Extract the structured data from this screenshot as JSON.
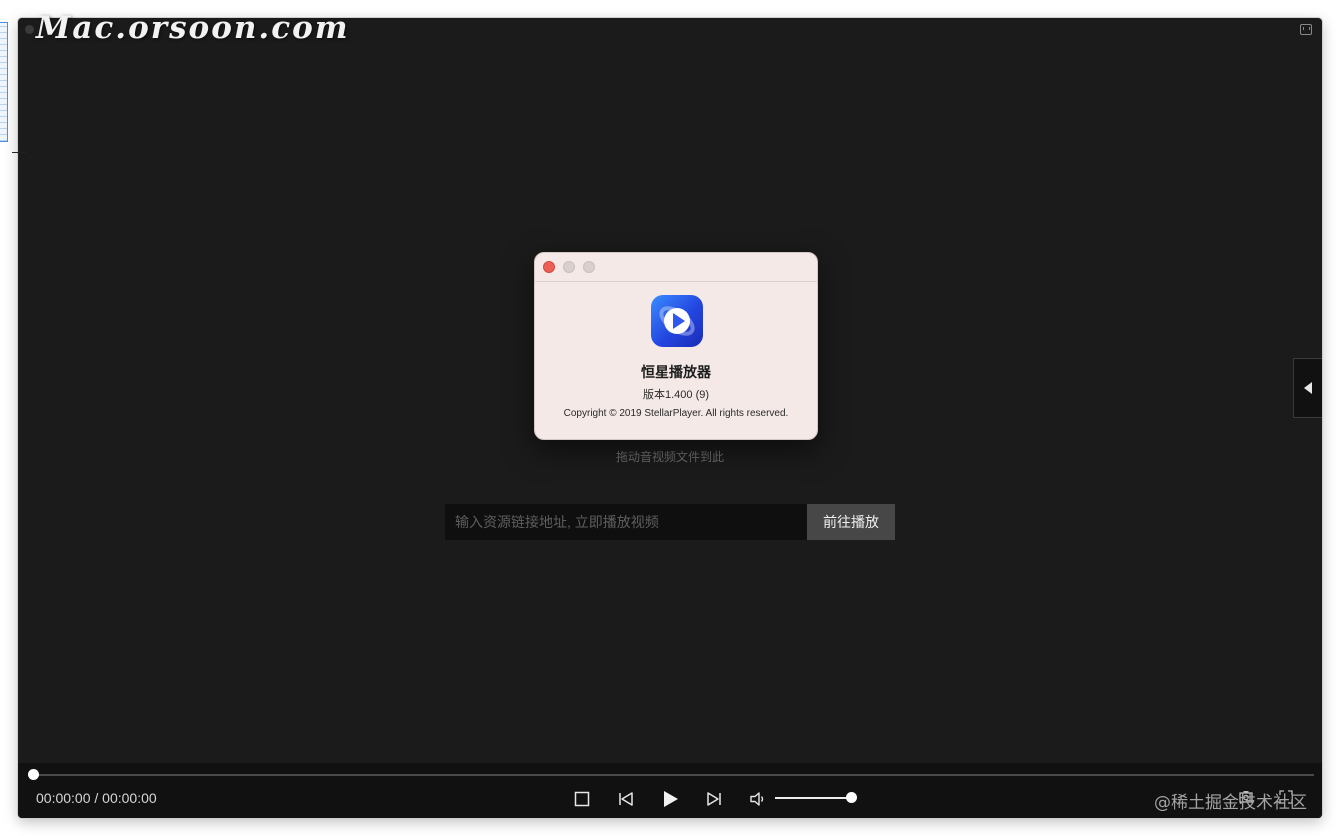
{
  "watermark": "Mac.orsoon.com",
  "about_dialog": {
    "app_name": "恒星播放器",
    "version": "版本1.400 (9)",
    "copyright": "Copyright © 2019 StellarPlayer. All rights reserved."
  },
  "player": {
    "drop_hint": "拖动音视频文件到此",
    "url_input": {
      "placeholder": "输入资源链接地址, 立即播放视频",
      "value": ""
    },
    "go_button_label": "前往播放",
    "time": "00:00:00 / 00:00:00",
    "progress": 0,
    "volume": 1.0
  },
  "icons": {
    "stop": "stop-icon",
    "prev": "skip-previous-icon",
    "play": "play-icon",
    "next": "skip-next-icon",
    "volume": "volume-icon",
    "screenshot": "screenshot-icon",
    "fullscreen": "fullscreen-icon",
    "side_panel": "chevron-left-icon",
    "pip": "picture-in-picture-icon"
  },
  "colors": {
    "background": "#1b1b1b",
    "controls": "#111111",
    "dialog": "#f4e9e6",
    "accent": "#2346e0",
    "close": "#ec5f57"
  },
  "bottom_right_watermark": "@稀土掘金技术社区"
}
